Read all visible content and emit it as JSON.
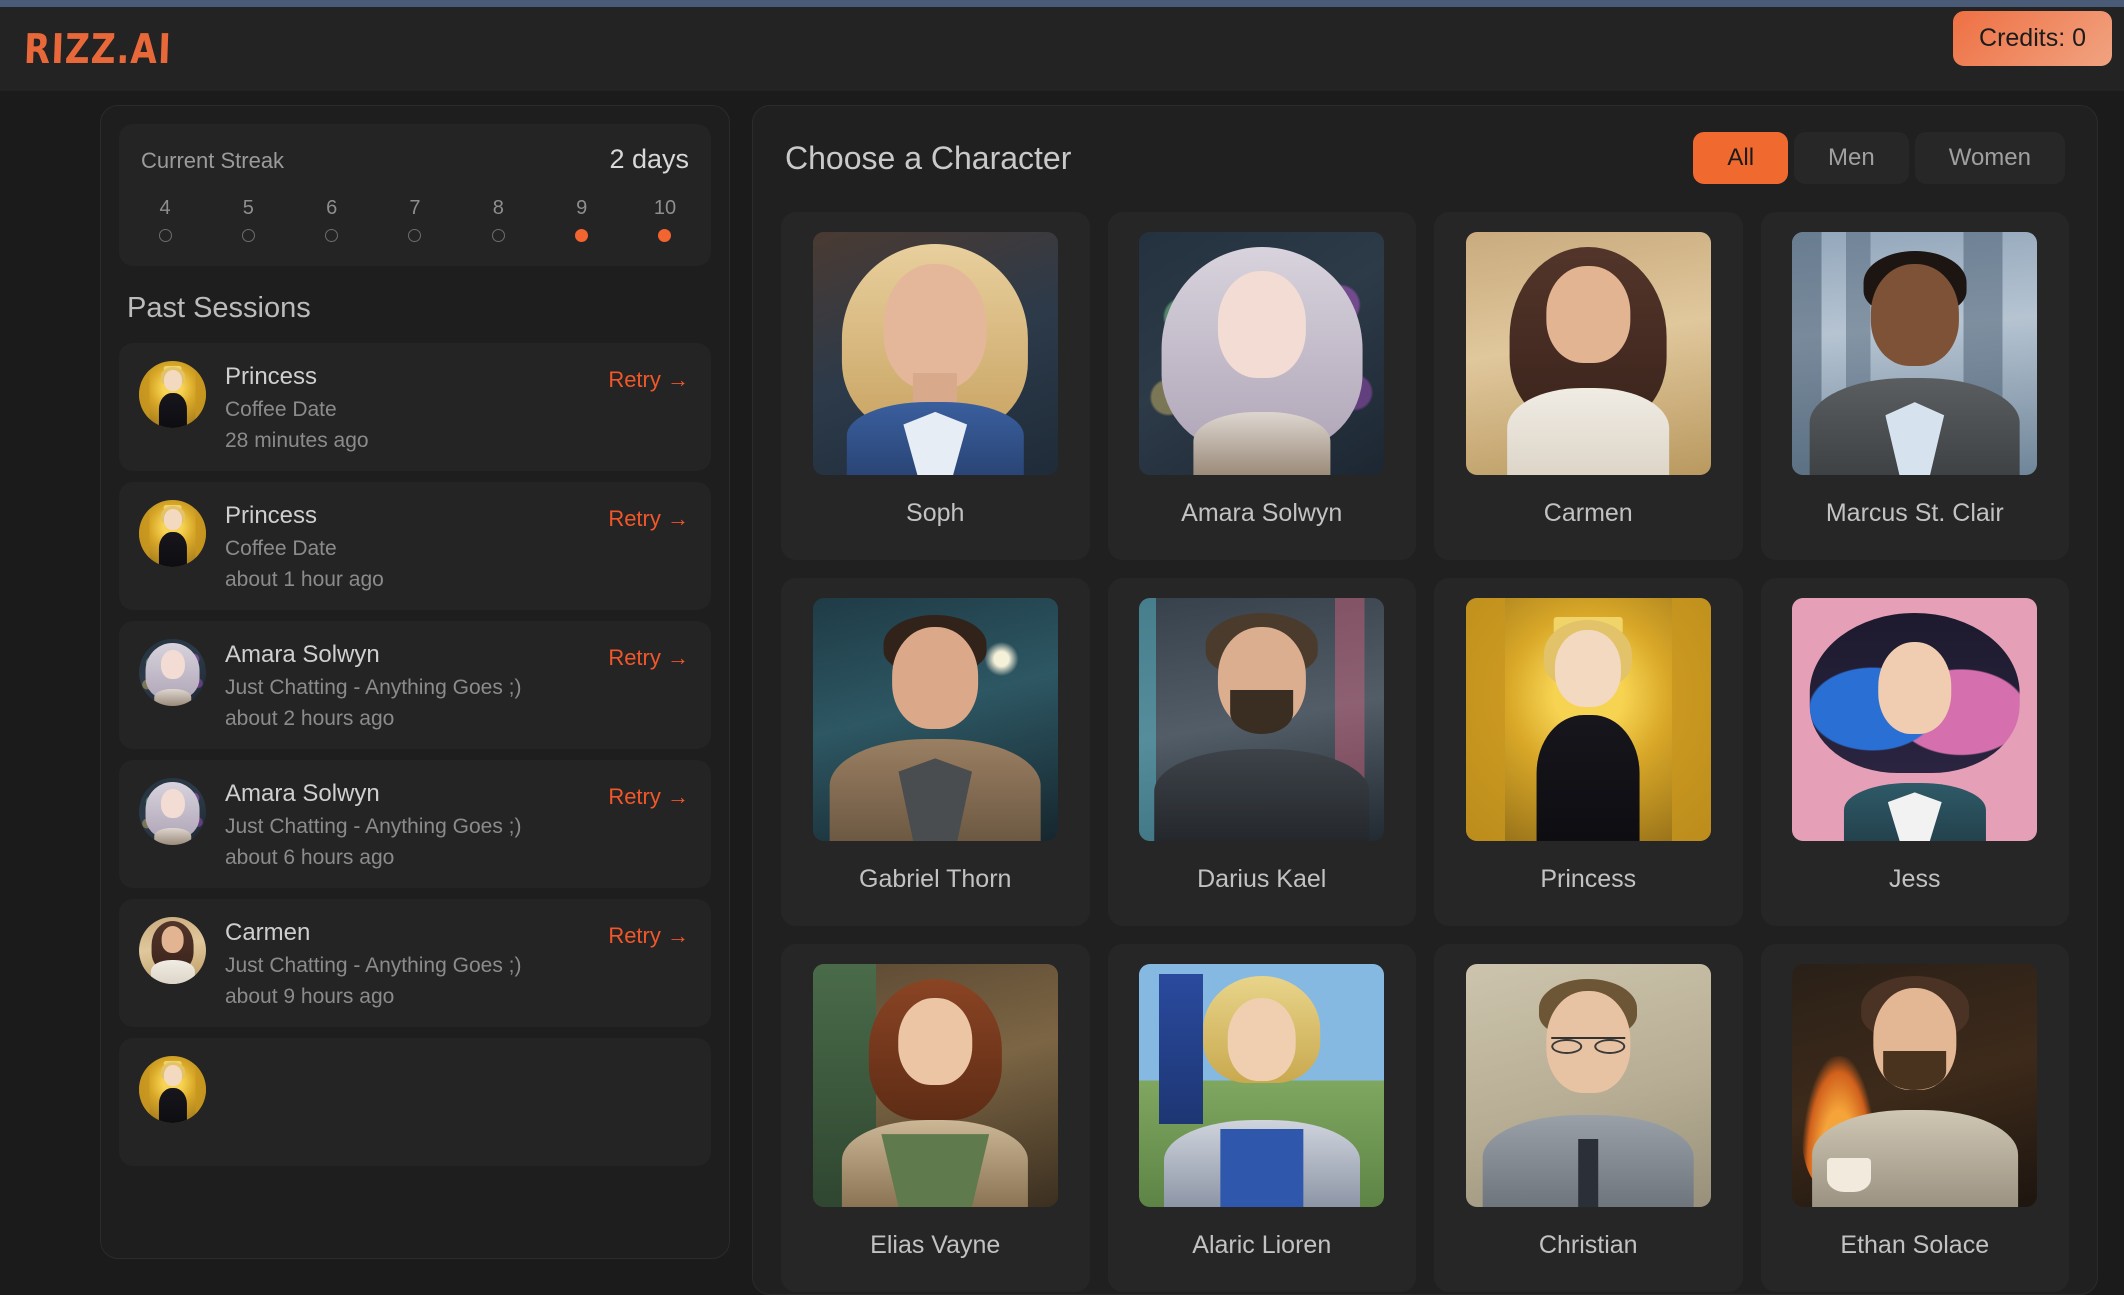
{
  "header": {
    "logo": "RIZZ.AI",
    "credits_label": "Credits: 0"
  },
  "colors": {
    "accent": "#f0692f",
    "accent_text": "#f0572a",
    "logo": "#e8683a",
    "page_bg": "#1b1b1b",
    "panel_bg": "#1e1e1e",
    "card_bg": "#242424"
  },
  "sidebar": {
    "streak": {
      "label": "Current Streak",
      "value": "2 days",
      "days": [
        {
          "num": "4",
          "filled": false
        },
        {
          "num": "5",
          "filled": false
        },
        {
          "num": "6",
          "filled": false
        },
        {
          "num": "7",
          "filled": false
        },
        {
          "num": "8",
          "filled": false
        },
        {
          "num": "9",
          "filled": true
        },
        {
          "num": "10",
          "filled": true
        }
      ]
    },
    "past_sessions_title": "Past Sessions",
    "retry_label": "Retry",
    "retry_icon": "arrow-right-icon",
    "sessions": [
      {
        "name": "Princess",
        "scenario": "Coffee Date",
        "time": "28 minutes ago",
        "art": "p-princess"
      },
      {
        "name": "Princess",
        "scenario": "Coffee Date",
        "time": "about 1 hour ago",
        "art": "p-princess"
      },
      {
        "name": "Amara Solwyn",
        "scenario": "Just Chatting - Anything Goes ;)",
        "time": "about 2 hours ago",
        "art": "p-amara"
      },
      {
        "name": "Amara Solwyn",
        "scenario": "Just Chatting - Anything Goes ;)",
        "time": "about 6 hours ago",
        "art": "p-amara"
      },
      {
        "name": "Carmen",
        "scenario": "Just Chatting - Anything Goes ;)",
        "time": "about 9 hours ago",
        "art": "p-carmen"
      },
      {
        "name": "",
        "scenario": "",
        "time": "",
        "art": "p-princess"
      }
    ]
  },
  "main": {
    "title": "Choose a Character",
    "filters": [
      {
        "label": "All",
        "active": true
      },
      {
        "label": "Men",
        "active": false
      },
      {
        "label": "Women",
        "active": false
      }
    ],
    "characters": [
      {
        "name": "Soph",
        "art": "p-soph"
      },
      {
        "name": "Amara Solwyn",
        "art": "p-amara"
      },
      {
        "name": "Carmen",
        "art": "p-carmen"
      },
      {
        "name": "Marcus St. Clair",
        "art": "p-marcus"
      },
      {
        "name": "Gabriel Thorn",
        "art": "p-gabriel"
      },
      {
        "name": "Darius Kael",
        "art": "p-darius"
      },
      {
        "name": "Princess",
        "art": "p-princess"
      },
      {
        "name": "Jess",
        "art": "p-jess"
      },
      {
        "name": "Elias Vayne",
        "art": "p-elias"
      },
      {
        "name": "Alaric Lioren",
        "art": "p-alaric"
      },
      {
        "name": "Christian",
        "art": "p-christian"
      },
      {
        "name": "Ethan Solace",
        "art": "p-ethan"
      }
    ]
  }
}
